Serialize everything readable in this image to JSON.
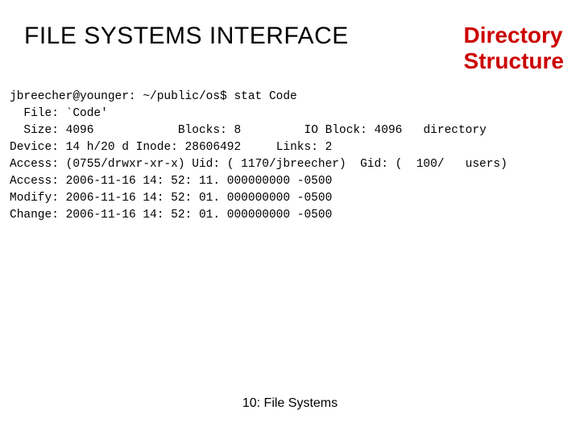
{
  "header": {
    "title": "FILE SYSTEMS INTERFACE",
    "subtitle_line1": "Directory",
    "subtitle_line2": "Structure"
  },
  "stat": {
    "prompt": "jbreecher@younger: ~/public/os$ stat Code",
    "file_label": "  File:",
    "file_value": "`Code'",
    "size_label": "  Size:",
    "size_value": "4096",
    "blocks_label": "Blocks:",
    "blocks_value": "8",
    "ioblock_label": "IO Block:",
    "ioblock_value": "4096",
    "type": "directory",
    "device_label": "Device:",
    "device_value": "14 h/20 d Inode: 28606492",
    "links_label": "Links:",
    "links_value": "2",
    "access1_label": "Access:",
    "access1_value": "(0755/drwxr-xr-x) Uid: ( 1170/jbreecher)",
    "gid_label": "Gid:",
    "gid_value": "(  100/   users)",
    "access2_label": "Access:",
    "access2_value": "2006-11-16 14: 52: 11. 000000000 -0500",
    "modify_label": "Modify:",
    "modify_value": "2006-11-16 14: 52: 01. 000000000 -0500",
    "change_label": "Change:",
    "change_value": "2006-11-16 14: 52: 01. 000000000 -0500"
  },
  "footer": "10: File Systems"
}
